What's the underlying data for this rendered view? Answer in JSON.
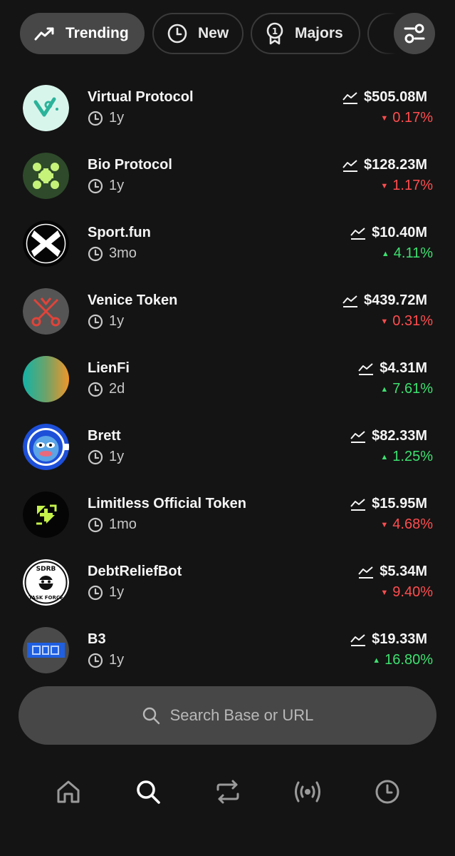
{
  "filters": {
    "tabs": [
      {
        "label": "Trending",
        "icon": "trending-up-icon",
        "active": true
      },
      {
        "label": "New",
        "icon": "clock-icon",
        "active": false
      },
      {
        "label": "Majors",
        "icon": "award-badge-icon",
        "active": false
      }
    ],
    "settings_icon": "sliders-icon"
  },
  "tokens": [
    {
      "name": "Virtual Protocol",
      "age": "1y",
      "market_cap": "$505.08M",
      "change": "0.17%",
      "direction": "down"
    },
    {
      "name": "Bio Protocol",
      "age": "1y",
      "market_cap": "$128.23M",
      "change": "1.17%",
      "direction": "down"
    },
    {
      "name": "Sport.fun",
      "age": "3mo",
      "market_cap": "$10.40M",
      "change": "4.11%",
      "direction": "up"
    },
    {
      "name": "Venice Token",
      "age": "1y",
      "market_cap": "$439.72M",
      "change": "0.31%",
      "direction": "down"
    },
    {
      "name": "LienFi",
      "age": "2d",
      "market_cap": "$4.31M",
      "change": "7.61%",
      "direction": "up"
    },
    {
      "name": "Brett",
      "age": "1y",
      "market_cap": "$82.33M",
      "change": "1.25%",
      "direction": "up"
    },
    {
      "name": "Limitless Official Token",
      "age": "1mo",
      "market_cap": "$15.95M",
      "change": "4.68%",
      "direction": "down"
    },
    {
      "name": "DebtReliefBot",
      "age": "1y",
      "market_cap": "$5.34M",
      "change": "9.40%",
      "direction": "down"
    },
    {
      "name": "B3",
      "age": "1y",
      "market_cap": "$19.33M",
      "change": "16.80%",
      "direction": "up"
    }
  ],
  "logo_text": {
    "debtreliefbot_top": "SDRB",
    "debtreliefbot_bottom": "TASK FORCE"
  },
  "search": {
    "placeholder": "Search Base or URL"
  },
  "nav": [
    "home-icon",
    "search-icon",
    "swap-icon",
    "broadcast-icon",
    "history-icon"
  ],
  "colors": {
    "down": "#ff4d4f",
    "up": "#3ee070",
    "background": "#141414",
    "surface": "#474747"
  }
}
